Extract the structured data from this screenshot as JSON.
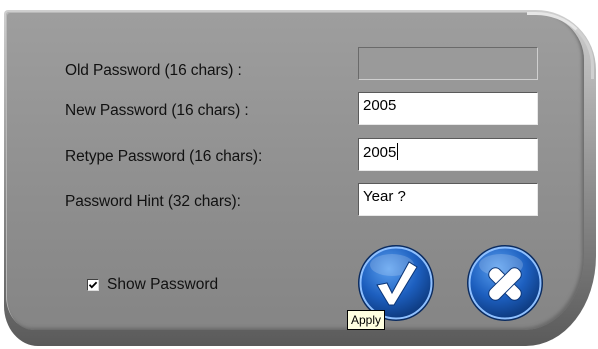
{
  "form": {
    "old_password_label": "Old Password (16 chars) :",
    "old_password_value": "",
    "new_password_label": "New Password (16 chars) :",
    "new_password_value": "2005",
    "retype_password_label": "Retype Password (16 chars):",
    "retype_password_value": "2005",
    "hint_label": "Password Hint (32 chars):",
    "hint_value": "Year ?"
  },
  "options": {
    "show_password_label": "Show Password",
    "show_password_checked": true
  },
  "buttons": {
    "apply_icon": "checkmark-icon",
    "cancel_icon": "close-icon",
    "tooltip": "Apply"
  },
  "colors": {
    "button_blue": "#1d5fbf",
    "dialog_gray": "#949494"
  }
}
